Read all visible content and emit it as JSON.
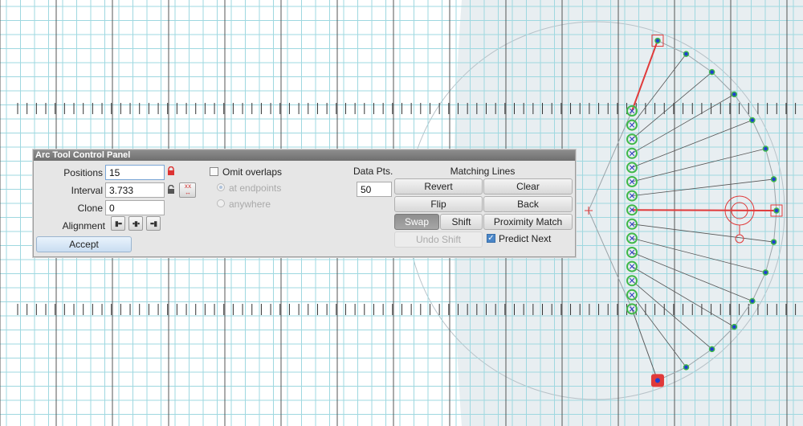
{
  "panel": {
    "title": "Arc Tool Control Panel",
    "positions_label": "Positions",
    "positions_value": "15",
    "interval_label": "Interval",
    "interval_value": "3.733",
    "clone_label": "Clone",
    "clone_value": "0",
    "alignment_label": "Alignment",
    "accept_label": "Accept",
    "omit_overlaps_label": "Omit overlaps",
    "omit_overlaps_checked": false,
    "radio_endpoints_label": "at endpoints",
    "radio_anywhere_label": "anywhere",
    "data_pts_label": "Data Pts.",
    "data_pts_value": "50",
    "matching_lines_label": "Matching Lines",
    "revert_label": "Revert",
    "clear_label": "Clear",
    "flip_label": "Flip",
    "back_label": "Back",
    "swap_label": "Swap",
    "shift_label": "Shift",
    "proximity_match_label": "Proximity Match",
    "undo_shift_label": "Undo Shift",
    "predict_next_label": "Predict Next",
    "predict_next_checked": true
  },
  "icons": {
    "lock_closed": "lock-icon",
    "lock_open": "unlock-icon",
    "swap_xx": "swap-xx-icon",
    "align_left": "align-left-icon",
    "align_center": "align-center-icon",
    "align_right": "align-right-icon"
  },
  "colors": {
    "grid_minor": "#9fd8e0",
    "grid_major": "#555555",
    "arc_fill": "#e8eef1",
    "point_green": "#3fb84a",
    "point_blue": "#1f3fd0",
    "line_red": "#e03a3a"
  }
}
